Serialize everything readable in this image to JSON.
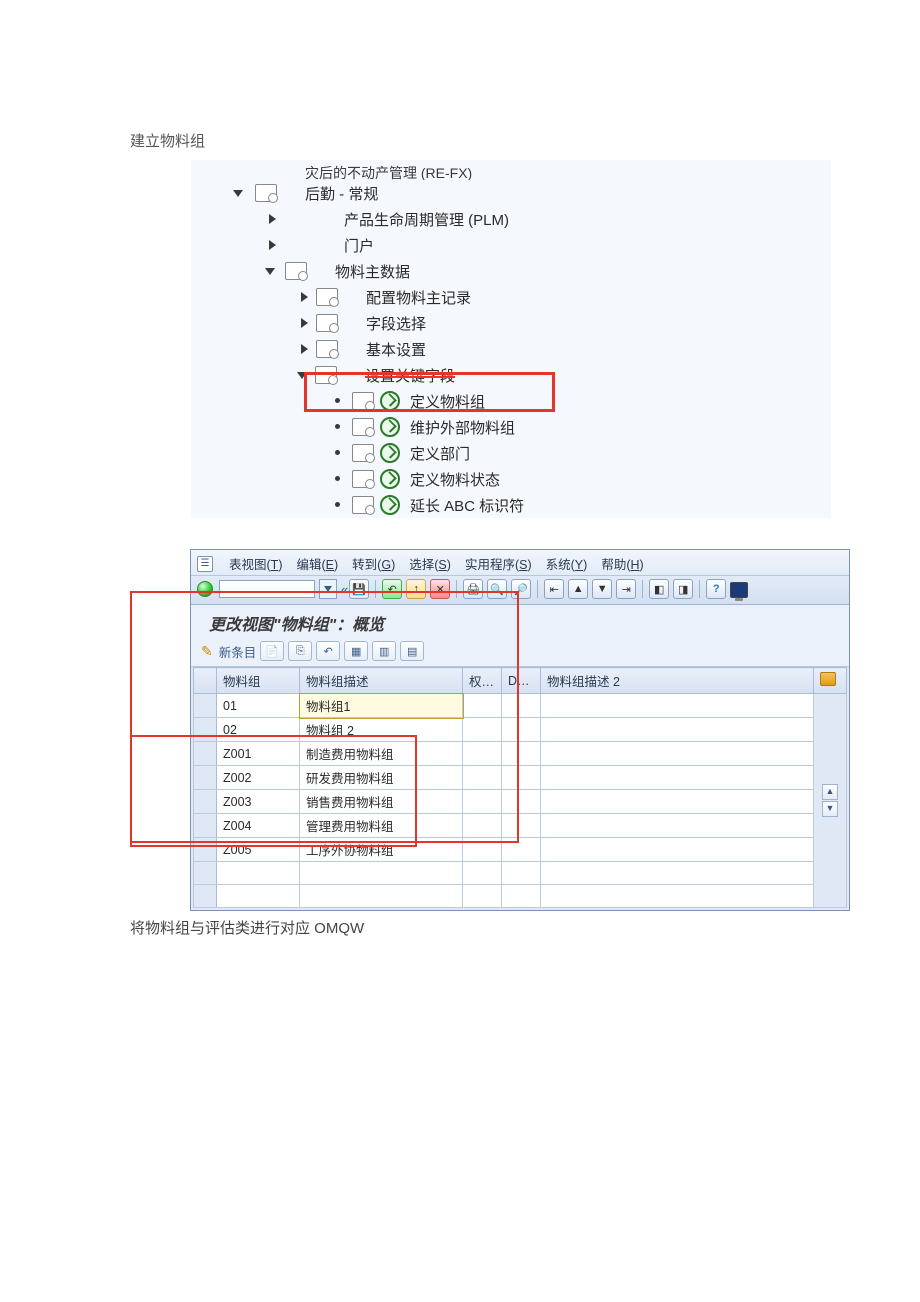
{
  "doc": {
    "heading1": "建立物料组",
    "heading2": "将物料组与评估类进行对应 OMQW"
  },
  "tree": {
    "row_cut": "灾后的不动产管理 (RE-FX)",
    "n1": "后勤 - 常规",
    "n2": "产品生命周期管理 (PLM)",
    "n3": "门户",
    "n4": "物料主数据",
    "n5": "配置物料主记录",
    "n6": "字段选择",
    "n7": "基本设置",
    "n8": "设置关键字段",
    "leaf1": "定义物料组",
    "leaf2": "维护外部物料组",
    "leaf3": "定义部门",
    "leaf4": "定义物料状态",
    "leaf5": "延长 ABC 标识符"
  },
  "menu": {
    "m1a": "表视图(",
    "m1b": "T",
    "m1c": ")",
    "m2a": "编辑(",
    "m2b": "E",
    "m2c": ")",
    "m3a": "转到(",
    "m3b": "G",
    "m3c": ")",
    "m4a": "选择(",
    "m4b": "S",
    "m4c": ")",
    "m5a": "实用程序(",
    "m5b": "S",
    "m5c": ")",
    "m6a": "系统(",
    "m6b": "Y",
    "m6c": ")",
    "m7a": "帮助(",
    "m7b": "H",
    "m7c": ")"
  },
  "view": {
    "title": "更改视图\"物料组\"：概览",
    "new_entries": "新条目"
  },
  "cols": {
    "c1": "物料组",
    "c2": "物料组描述",
    "c3": "权…",
    "c4": "D…",
    "c5": "物料组描述 2"
  },
  "rows": [
    {
      "code": "01",
      "desc": "物料组1"
    },
    {
      "code": "02",
      "desc": "物料组 2"
    },
    {
      "code": "Z001",
      "desc": "制造费用物料组"
    },
    {
      "code": "Z002",
      "desc": "研发费用物料组"
    },
    {
      "code": "Z003",
      "desc": "销售费用物料组"
    },
    {
      "code": "Z004",
      "desc": "管理费用物料组"
    },
    {
      "code": "Z005",
      "desc": "工序外协物料组"
    }
  ],
  "glyph": {
    "save": "💾",
    "back": "←",
    "prn": "🖨",
    "find": "🔍",
    "page": "📄",
    "copy": "⎘",
    "undo": "↶",
    "sel": "▦",
    "help": "?",
    "chev_l": "«"
  }
}
